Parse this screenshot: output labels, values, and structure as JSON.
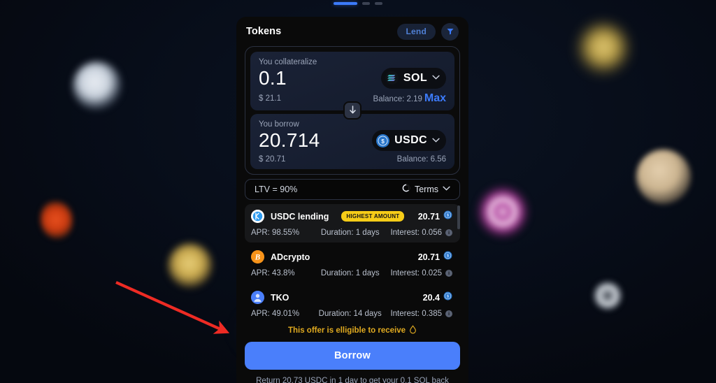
{
  "progress": {
    "steps": 3,
    "active_index": 0
  },
  "panel": {
    "title": "Tokens",
    "lend_label": "Lend",
    "filter_icon": "filter-funnel-icon"
  },
  "collateralize": {
    "label": "You collateralize",
    "amount": "0.1",
    "usd": "$ 21.1",
    "balance_label": "Balance: 2.19",
    "max_label": "Max",
    "token": "SOL",
    "token_icon": "solana-icon",
    "chevron": "⌄"
  },
  "swap_button": {
    "icon": "arrow-down-icon"
  },
  "borrow_input": {
    "label": "You borrow",
    "amount": "20.714",
    "usd": "$ 20.71",
    "balance_label": "Balance: 6.56",
    "token": "USDC",
    "token_icon": "usdc-coin-icon"
  },
  "ltv": {
    "text": "LTV = 90%",
    "terms_label": "Terms",
    "terms_icon": "circle-terms-icon"
  },
  "offers": [
    {
      "name": "USDC lending",
      "badge": "HIGHEST AMOUNT",
      "amount": "20.71",
      "amount_icon": "usdc-coin-icon",
      "apr": "APR: 98.55%",
      "duration": "Duration: 1 days",
      "interest": "Interest: 0.056",
      "info_icon": "info-icon",
      "avatar": "usdc-avatar",
      "selected": true
    },
    {
      "name": "ADcrypto",
      "badge": "",
      "amount": "20.71",
      "amount_icon": "usdc-coin-icon",
      "apr": "APR: 43.8%",
      "duration": "Duration: 1 days",
      "interest": "Interest: 0.025",
      "info_icon": "info-icon",
      "avatar": "bitcoin-avatar",
      "selected": false
    },
    {
      "name": "TKO",
      "badge": "",
      "amount": "20.4",
      "amount_icon": "usdc-coin-icon",
      "apr": "APR: 49.01%",
      "duration": "Duration: 14 days",
      "interest": "Interest: 0.385",
      "info_icon": "info-icon",
      "avatar": "person-avatar",
      "selected": false
    }
  ],
  "eligible": {
    "text": "This offer is elligible to receive",
    "icon": "droplet-icon"
  },
  "action": {
    "borrow_label": "Borrow",
    "return_note": "Return 20.73 USDC in 1 day to get your 0.1 SOL back"
  },
  "colors": {
    "accent_blue": "#4a7ffb",
    "badge_yellow": "#f6cc18",
    "eligible_gold": "#e0aa20",
    "panel_bg": "#0a0a0a",
    "input_bg": "#1a2236",
    "annotation_red": "#ee2b24"
  }
}
